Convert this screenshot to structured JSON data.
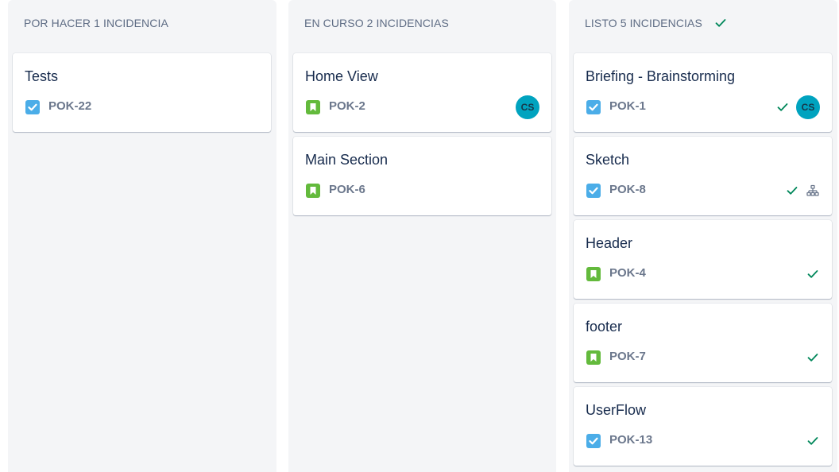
{
  "colors": {
    "column_bg": "#f4f5f7",
    "task": "#4bade8",
    "story": "#63ba3c",
    "done_check": "#00875a",
    "avatar": "#00a3bf",
    "key_text": "#6b778c"
  },
  "columns": [
    {
      "header": "POR HACER 1 INCIDENCIA",
      "show_done_icon": false,
      "cards": [
        {
          "title": "Tests",
          "type_icon": "task-checkbox-icon",
          "key": "POK-22",
          "done": false,
          "subtasks": false,
          "avatar": ""
        }
      ]
    },
    {
      "header": "EN CURSO 2 INCIDENCIAS",
      "show_done_icon": false,
      "cards": [
        {
          "title": "Home View",
          "type_icon": "story-bookmark-icon",
          "key": "POK-2",
          "done": false,
          "subtasks": false,
          "avatar": "CS"
        },
        {
          "title": "Main Section",
          "type_icon": "story-bookmark-icon",
          "key": "POK-6",
          "done": false,
          "subtasks": false,
          "avatar": ""
        }
      ]
    },
    {
      "header": "LISTO 5 INCIDENCIAS",
      "show_done_icon": true,
      "cards": [
        {
          "title": "Briefing - Brainstorming",
          "type_icon": "task-checkbox-icon",
          "key": "POK-1",
          "done": true,
          "subtasks": false,
          "avatar": "CS"
        },
        {
          "title": "Sketch",
          "type_icon": "task-checkbox-icon",
          "key": "POK-8",
          "done": true,
          "subtasks": true,
          "avatar": ""
        },
        {
          "title": "Header",
          "type_icon": "story-bookmark-icon",
          "key": "POK-4",
          "done": true,
          "subtasks": false,
          "avatar": ""
        },
        {
          "title": "footer",
          "type_icon": "story-bookmark-icon",
          "key": "POK-7",
          "done": true,
          "subtasks": false,
          "avatar": ""
        },
        {
          "title": "UserFlow",
          "type_icon": "task-checkbox-icon",
          "key": "POK-13",
          "done": true,
          "subtasks": false,
          "avatar": ""
        }
      ]
    }
  ]
}
